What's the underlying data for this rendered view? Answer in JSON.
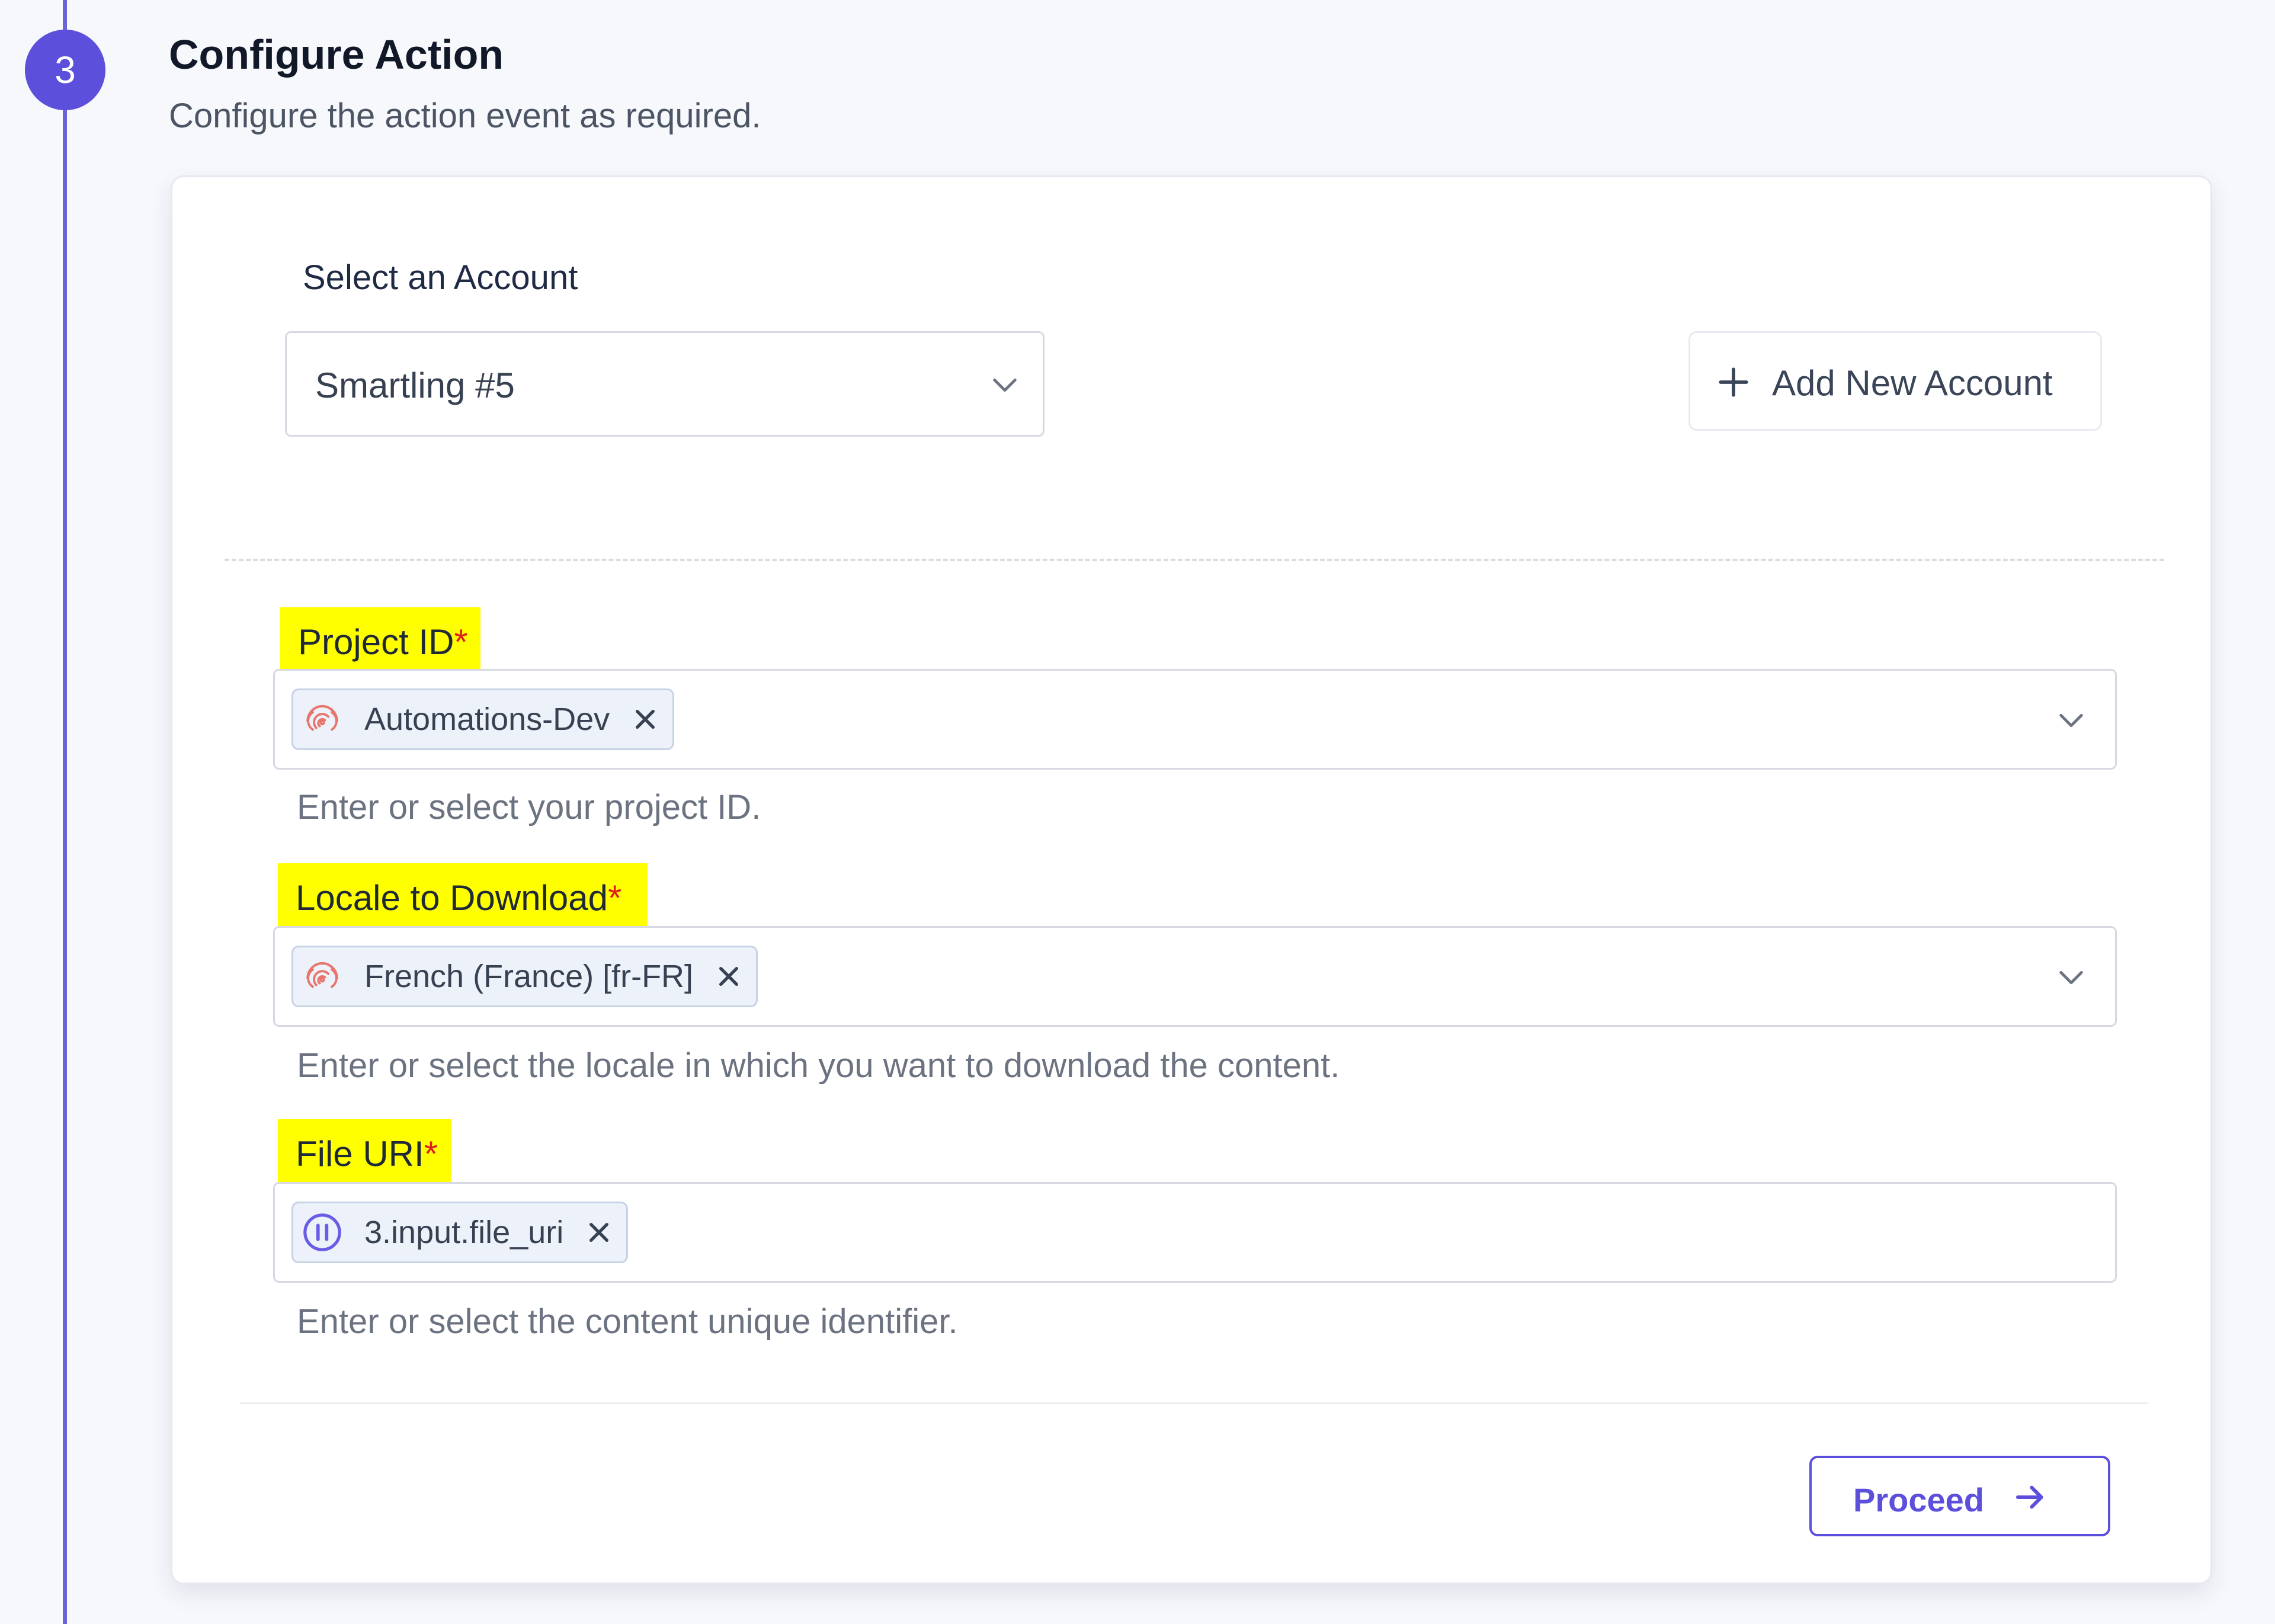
{
  "step": {
    "number": "3",
    "title": "Configure Action",
    "subtitle": "Configure the action event as required."
  },
  "account": {
    "label": "Select an Account",
    "selected": "Smartling #5",
    "add_button_label": "Add New Account"
  },
  "fields": [
    {
      "label": "Project ID",
      "required_mark": "*",
      "chip_icon": "fingerprint-icon",
      "chip_value": "Automations-Dev",
      "helper": "Enter or select your project ID."
    },
    {
      "label": "Locale to Download",
      "required_mark": "*",
      "chip_icon": "fingerprint-icon",
      "chip_value": "French (France) [fr-FR]",
      "helper": "Enter or select the locale in which you want to download the content."
    },
    {
      "label": "File URI",
      "required_mark": "*",
      "chip_icon": "pause-circle-icon",
      "chip_value": "3.input.file_uri",
      "helper": "Enter or select the content unique identifier."
    }
  ],
  "actions": {
    "proceed_label": "Proceed"
  },
  "colors": {
    "accent": "#5b4fdc",
    "highlight": "#ffff00",
    "required": "#e11d1d",
    "fingerprint": "#e8746b"
  }
}
